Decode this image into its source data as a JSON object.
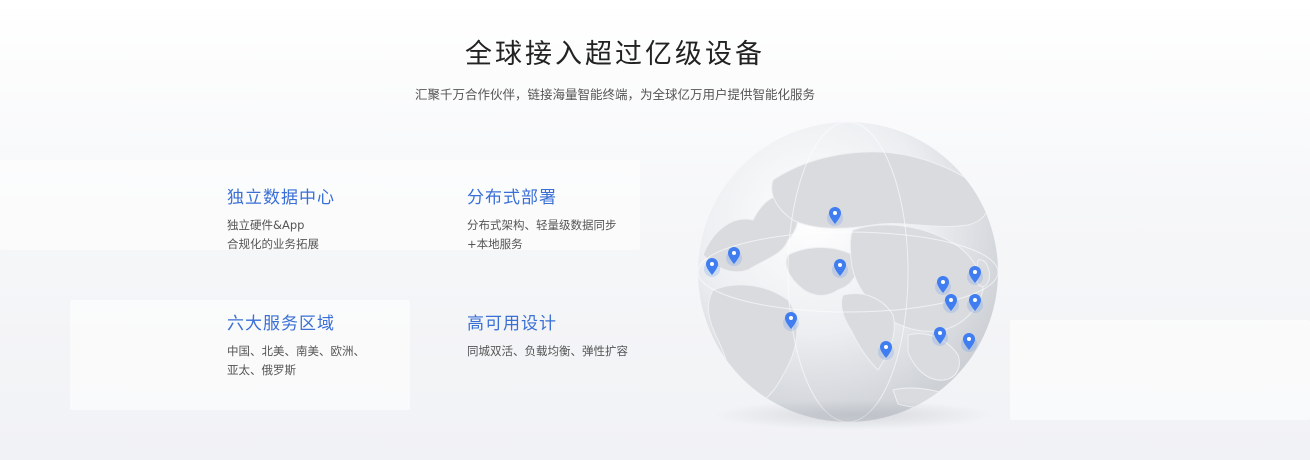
{
  "header": {
    "title": "全球接入超过亿级设备",
    "subtitle": "汇聚千万合作伙伴，链接海量智能终端，为全球亿万用户提供智能化服务"
  },
  "features": [
    {
      "title": "独立数据中心",
      "desc": "独立硬件&App\n合规化的业务拓展"
    },
    {
      "title": "分布式部署",
      "desc": "分布式架构、轻量级数据同步\n+本地服务"
    },
    {
      "title": "六大服务区域",
      "desc": "中国、北美、南美、欧洲、\n亚太、俄罗斯"
    },
    {
      "title": "高可用设计",
      "desc": "同城双活、负载均衡、弹性扩容"
    }
  ],
  "globe": {
    "pin_icon": "location-pin-icon",
    "pin_color": "#3f7df0"
  },
  "colors": {
    "accent": "#3a6fd6",
    "title": "#222222",
    "text": "#555555"
  }
}
